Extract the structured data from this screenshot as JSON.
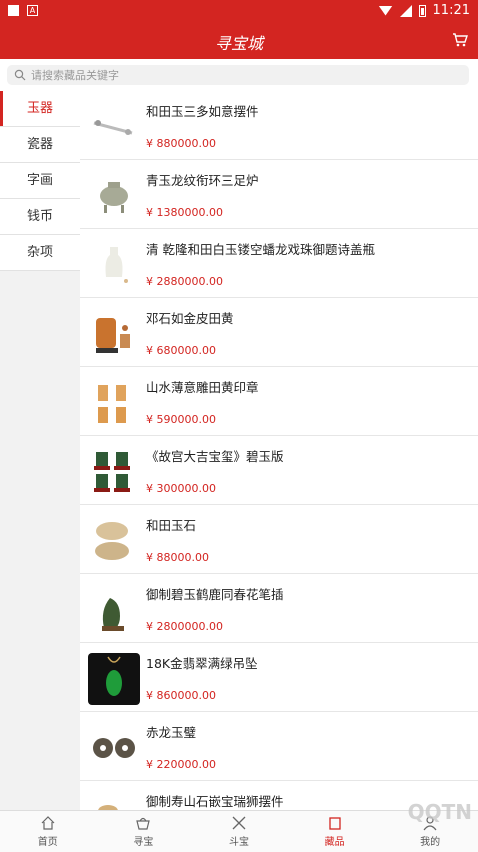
{
  "status": {
    "time": "11:21",
    "a_label": "A"
  },
  "header": {
    "title": "寻宝城"
  },
  "search": {
    "placeholder": "请搜索藏品关键字"
  },
  "sidebar": {
    "items": [
      {
        "label": "玉器"
      },
      {
        "label": "瓷器"
      },
      {
        "label": "字画"
      },
      {
        "label": "钱币"
      },
      {
        "label": "杂项"
      }
    ]
  },
  "products": [
    {
      "name": "和田玉三多如意摆件",
      "price": "¥ 880000.00"
    },
    {
      "name": "青玉龙纹衔环三足炉",
      "price": "¥ 1380000.00"
    },
    {
      "name": "清 乾隆和田白玉镂空蟠龙戏珠御题诗盖瓶",
      "price": "¥ 2880000.00"
    },
    {
      "name": "邓石如金皮田黄",
      "price": "¥ 680000.00"
    },
    {
      "name": "山水薄意雕田黄印章",
      "price": "¥ 590000.00"
    },
    {
      "name": "《故宫大吉宝玺》碧玉版",
      "price": "¥ 300000.00"
    },
    {
      "name": "和田玉石",
      "price": "¥ 88000.00"
    },
    {
      "name": "御制碧玉鹤鹿同春花笔插",
      "price": "¥ 2800000.00"
    },
    {
      "name": "18K金翡翠满绿吊坠",
      "price": "¥ 860000.00"
    },
    {
      "name": "赤龙玉璧",
      "price": "¥ 220000.00"
    },
    {
      "name": "御制寿山石嵌宝瑞狮摆件",
      "price": ""
    }
  ],
  "tabs": [
    {
      "label": "首页"
    },
    {
      "label": "寻宝"
    },
    {
      "label": "斗宝"
    },
    {
      "label": "藏品"
    },
    {
      "label": "我的"
    }
  ],
  "watermark": "QQTN",
  "colors": {
    "accent": "#d32521"
  }
}
